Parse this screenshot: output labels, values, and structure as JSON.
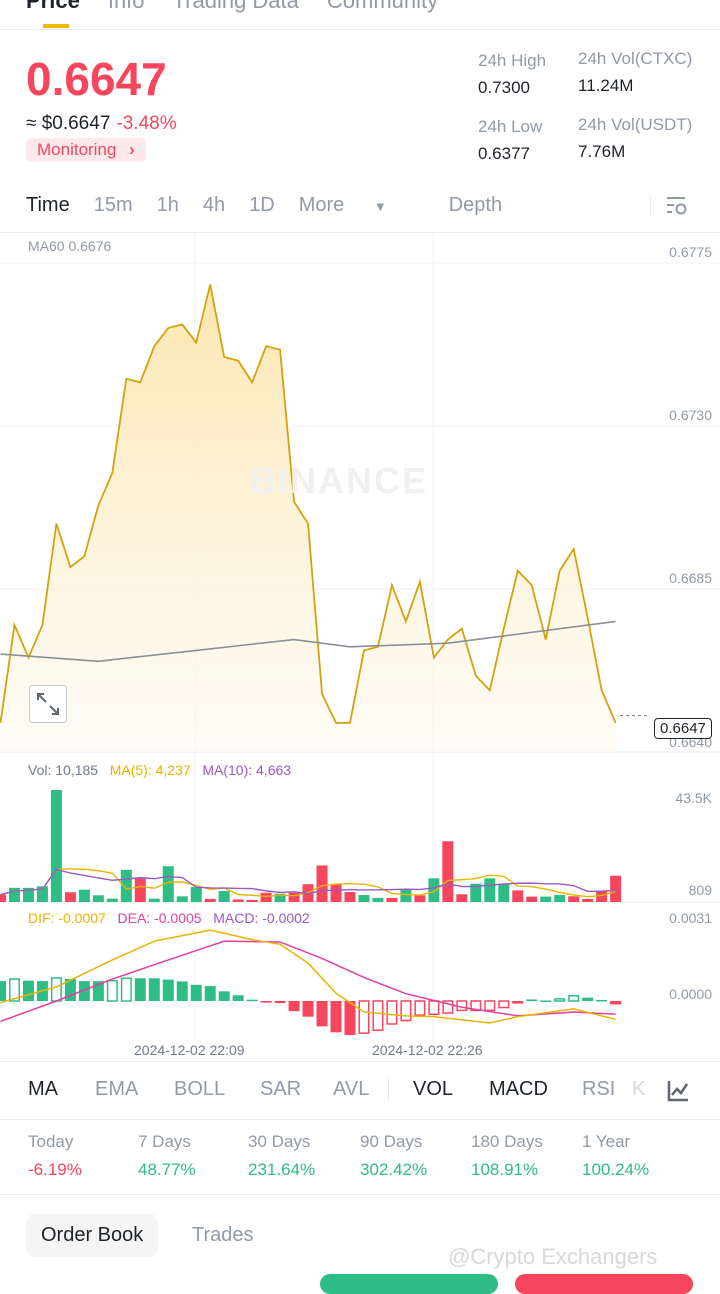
{
  "top_tabs": [
    "Price",
    "Info",
    "Trading Data",
    "Community"
  ],
  "price": {
    "last": "0.6647",
    "fiat": "≈ $0.6647",
    "change": "-3.48%",
    "monitoring": "Monitoring",
    "chevron": "›"
  },
  "stats": [
    {
      "label": "24h High",
      "value": "0.7300"
    },
    {
      "label": "24h Vol(CTXC)",
      "value": "11.24M"
    },
    {
      "label": "24h Low",
      "value": "0.6377"
    },
    {
      "label": "24h Vol(USDT)",
      "value": "7.76M"
    }
  ],
  "timeframes": {
    "items": [
      "Time",
      "15m",
      "1h",
      "4h",
      "1D",
      "More"
    ],
    "depth": "Depth",
    "dropdown": "▼"
  },
  "colors": {
    "up": "#2ebd85",
    "down": "#f6465d",
    "price_line": "#d4a20c",
    "ma60": "#8a8f97",
    "ma5": "#e8b400",
    "ma10": "#9b59c4",
    "dea": "#e040a0"
  },
  "watermark": "BINANCE",
  "chart_data": [
    {
      "type": "line",
      "name": "price",
      "legend": "MA60 0.6676",
      "yticks": [
        "0.6775",
        "0.6730",
        "0.6685",
        "0.6640"
      ],
      "ylim": [
        0.664,
        0.6775
      ],
      "current": "0.6647",
      "values": [
        0.6645,
        0.6672,
        0.6663,
        0.6672,
        0.67,
        0.6688,
        0.6691,
        0.6705,
        0.6714,
        0.674,
        0.6739,
        0.6749,
        0.6754,
        0.6755,
        0.675,
        0.6766,
        0.6746,
        0.6745,
        0.6739,
        0.6749,
        0.6748,
        0.6706,
        0.67,
        0.6653,
        0.6645,
        0.6645,
        0.6665,
        0.6666,
        0.6683,
        0.6673,
        0.6684,
        0.6663,
        0.6668,
        0.6671,
        0.6658,
        0.6654,
        0.6671,
        0.6687,
        0.6683,
        0.6668,
        0.6687,
        0.6693,
        0.6674,
        0.6654,
        0.6645
      ],
      "ma60": {
        "idx": [
          0,
          7,
          14,
          21,
          25,
          32,
          36,
          44
        ],
        "values": [
          0.6664,
          0.6662,
          0.6665,
          0.6668,
          0.6666,
          0.6667,
          0.6669,
          0.6673
        ]
      }
    },
    {
      "type": "bar",
      "name": "volume",
      "legend": {
        "vol": "Vol: 10,185",
        "ma5": "MA(5): 4,237",
        "ma10": "MA(10): 4,663"
      },
      "yticks": [
        "43.5K",
        "809"
      ],
      "ymax": 43.5,
      "values": [
        2.9,
        5.5,
        5.5,
        6.1,
        43.5,
        3.8,
        4.8,
        2.6,
        1.3,
        12.5,
        9.1,
        1.3,
        13.9,
        2.2,
        5.8,
        1.2,
        4.3,
        1.0,
        0.8,
        3.6,
        3.2,
        3.6,
        6.9,
        14.2,
        6.9,
        3.9,
        2.7,
        1.6,
        1.6,
        4.9,
        2.6,
        9.2,
        23.6,
        3.0,
        7.1,
        9.2,
        7.1,
        4.5,
        2.1,
        2.1,
        2.7,
        2.2,
        1.2,
        4.2,
        10.2
      ],
      "dir": "dggggdgggg dggggdgdddgdddddggdgdgddggg ddggddd"
    },
    {
      "type": "bar",
      "name": "macd",
      "legend": {
        "dif": "DIF: -0.0007",
        "dea": "DEA: -0.0005",
        "macd": "MACD: -0.0002"
      },
      "yticks": [
        "0.0031",
        "0.0000"
      ],
      "ymax": 0.0031,
      "hist": [
        0.00076,
        0.00084,
        0.00078,
        0.00076,
        0.00088,
        0.00084,
        0.00076,
        0.00076,
        0.00078,
        0.00087,
        0.00087,
        0.00087,
        0.00082,
        0.00075,
        0.00062,
        0.00057,
        0.00037,
        0.00022,
        5e-05,
        -6e-05,
        -8e-05,
        -0.00039,
        -0.0006,
        -0.00097,
        -0.0012,
        -0.0013,
        -0.00123,
        -0.00112,
        -0.00088,
        -0.00075,
        -0.00054,
        -0.00051,
        -0.00046,
        -0.00036,
        -0.00036,
        -0.00036,
        -0.00025,
        -0.0001,
        6e-05,
        2e-05,
        8e-05,
        0.0002,
        0.00013,
        4e-05,
        -0.00013
      ],
      "hollow": [
        1,
        4,
        8,
        9,
        26,
        27,
        28,
        29,
        30,
        31,
        32,
        33,
        34,
        35,
        36,
        40,
        41
      ],
      "dif": {
        "idx": [
          0,
          4,
          8,
          11,
          15,
          18,
          20,
          22,
          24,
          26,
          29,
          31,
          35,
          37,
          41,
          44
        ],
        "values": [
          -6e-05,
          0.00054,
          0.00157,
          0.00229,
          0.00271,
          0.00235,
          0.00217,
          0.00145,
          0.0003,
          -0.00042,
          -0.00057,
          -0.0006,
          -0.00084,
          -0.0006,
          -0.0003,
          -0.0007
        ]
      },
      "dea": {
        "idx": [
          0,
          4,
          8,
          12,
          16,
          20,
          23,
          26,
          29,
          33,
          37,
          41,
          44
        ],
        "values": [
          -0.00078,
          0,
          0.00084,
          0.00157,
          0.00229,
          0.00226,
          0.00163,
          0.0009,
          0.00028,
          -0.00024,
          -0.00057,
          -0.00042,
          -0.0005
        ]
      },
      "xlabels": [
        "2024-12-02 22:09",
        "2024-12-02 22:26"
      ]
    }
  ],
  "indicators": [
    "MA",
    "EMA",
    "BOLL",
    "SAR",
    "AVL",
    "VOL",
    "MACD",
    "RSI",
    "K"
  ],
  "performance": [
    {
      "label": "Today",
      "value": "-6.19%"
    },
    {
      "label": "7 Days",
      "value": "48.77%"
    },
    {
      "label": "30 Days",
      "value": "231.64%"
    },
    {
      "label": "90 Days",
      "value": "302.42%"
    },
    {
      "label": "180 Days",
      "value": "108.91%"
    },
    {
      "label": "1 Year",
      "value": "100.24%"
    }
  ],
  "bottom_tabs": {
    "order_book": "Order Book",
    "trades": "Trades"
  },
  "watermark_credit": "@Crypto Exchangers"
}
